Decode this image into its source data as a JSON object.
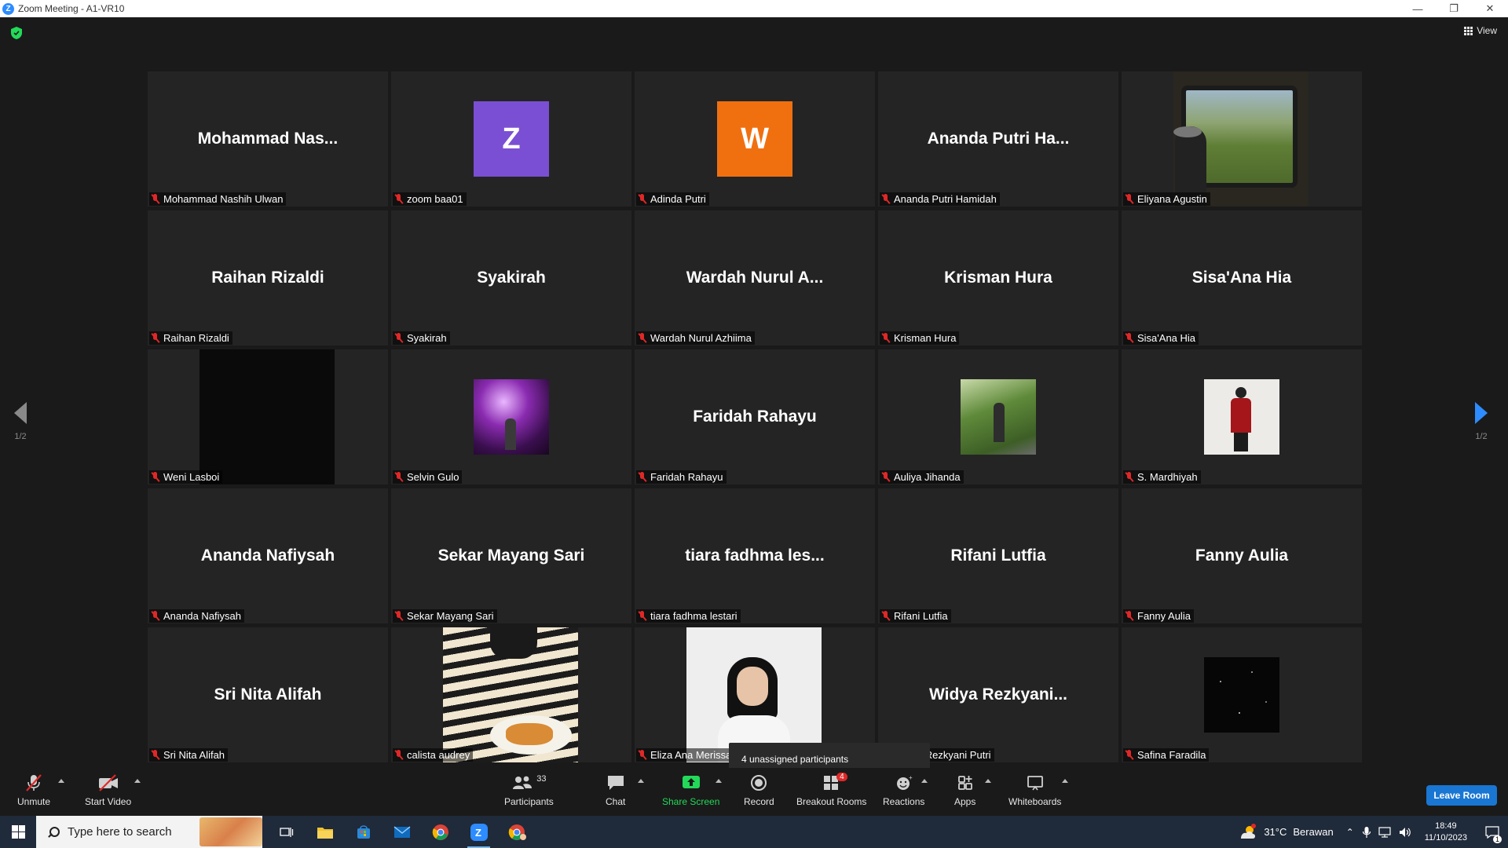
{
  "window": {
    "title": "Zoom Meeting - A1-VR10",
    "app_letter": "Z"
  },
  "view": {
    "label": "View"
  },
  "pagination": {
    "left": "1/2",
    "right": "1/2"
  },
  "tiles": [
    {
      "name": "Mohammad  Nas...",
      "label": "Mohammad Nashih Ulwan"
    },
    {
      "avatar": "Z",
      "avatar_color": "#7b4fd3",
      "label": "zoom baa01"
    },
    {
      "avatar": "W",
      "avatar_color": "#f07010",
      "label": "Adinda Putri"
    },
    {
      "name": "Ananda Putri Ha...",
      "label": "Ananda Putri Hamidah"
    },
    {
      "photo": "train-window",
      "label": "Eliyana Agustin"
    },
    {
      "name": "Raihan Rizaldi",
      "label": "Raihan Rizaldi"
    },
    {
      "name": "Syakirah",
      "label": "Syakirah"
    },
    {
      "name": "Wardah Nurul A...",
      "label": "Wardah Nurul Azhiima"
    },
    {
      "name": "Krisman Hura",
      "label": "Krisman Hura"
    },
    {
      "name": "Sisa'Ana Hia",
      "label": "Sisa'Ana Hia"
    },
    {
      "photo": "black-video",
      "label": "Weni Lasboi"
    },
    {
      "photo": "purple-lights",
      "label": "Selvin Gulo"
    },
    {
      "name": "Faridah Rahayu",
      "label": "Faridah Rahayu"
    },
    {
      "photo": "garden",
      "label": "Auliya Jihanda"
    },
    {
      "photo": "red-jacket",
      "label": "S. Mardhiyah"
    },
    {
      "name": "Ananda Nafiysah",
      "label": "Ananda Nafiysah"
    },
    {
      "name": "Sekar Mayang Sari",
      "label": "Sekar Mayang Sari"
    },
    {
      "name": "tiara fadhma les...",
      "label": "tiara fadhma lestari"
    },
    {
      "name": "Rifani Lutfia",
      "label": "Rifani Lutfia"
    },
    {
      "name": "Fanny Aulia",
      "label": "Fanny Aulia"
    },
    {
      "name": "Sri Nita Alifah",
      "label": "Sri Nita Alifah"
    },
    {
      "photo": "food-video",
      "label": "calista audrey"
    },
    {
      "photo": "girl-video",
      "label": "Eliza Ana Merissa"
    },
    {
      "name": "Widya  Rezkyani...",
      "label": "Widya Rezkyani Putri"
    },
    {
      "photo": "starry",
      "label": "Safina Faradila"
    }
  ],
  "tooltip": {
    "text": "4 unassigned participants"
  },
  "toolbar": {
    "unmute": "Unmute",
    "start_video": "Start Video",
    "participants": "Participants",
    "participants_count": "33",
    "chat": "Chat",
    "share_screen": "Share Screen",
    "record": "Record",
    "breakout_rooms": "Breakout Rooms",
    "breakout_badge": "4",
    "reactions": "Reactions",
    "apps": "Apps",
    "whiteboards": "Whiteboards",
    "leave": "Leave Room"
  },
  "taskbar": {
    "search_placeholder": "Type here to search",
    "weather_temp": "31°C",
    "weather_text": "Berawan",
    "time": "18:49",
    "date": "11/10/2023",
    "notif_count": "1"
  },
  "colors": {
    "accent": "#2d8cff",
    "share_green": "#23d959",
    "muted_red": "#e02828",
    "leave_blue": "#1976d2"
  }
}
